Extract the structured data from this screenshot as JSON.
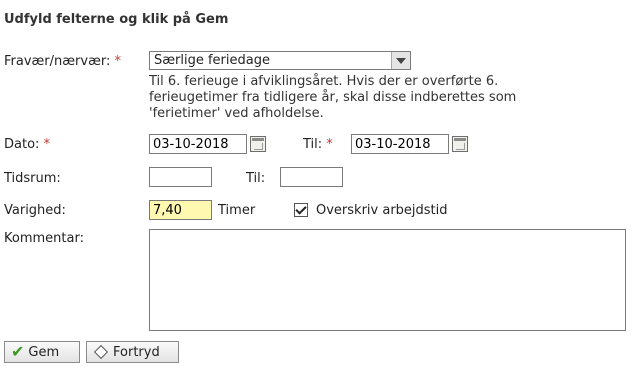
{
  "form": {
    "title": "Udfyld felterne og klik på Gem",
    "absence": {
      "label": "Fravær/nærvær:",
      "required_mark": "*",
      "selected": "Særlige feriedage",
      "help_text": "Til 6. ferieuge i afviklingsåret. Hvis der er overførte 6. ferieugetimer fra tidligere år, skal disse indberettes som 'ferietimer' ved afholdelse."
    },
    "date": {
      "label": "Dato:",
      "required_mark": "*",
      "value": "03-10-2018",
      "to_label": "Til:",
      "to_required_mark": "*",
      "to_value": "03-10-2018"
    },
    "timespan": {
      "label": "Tidsrum:",
      "from_value": "",
      "to_label": "Til:",
      "to_value": ""
    },
    "duration": {
      "label": "Varighed:",
      "value": "7,40",
      "unit": "Timer",
      "overwrite_label": "Overskriv arbejdstid",
      "overwrite_checked": true
    },
    "comment": {
      "label": "Kommentar:",
      "value": ""
    }
  },
  "buttons": {
    "save_label": "Gem",
    "cancel_label": "Fortryd"
  },
  "icons": {
    "save": "check-icon",
    "cancel": "diamond-icon",
    "calendar": "calendar-icon",
    "dropdown": "chevron-down-icon"
  },
  "colors": {
    "required": "#c0392b",
    "highlight_input": "#fff8b0",
    "save_check": "#3a9b22"
  }
}
